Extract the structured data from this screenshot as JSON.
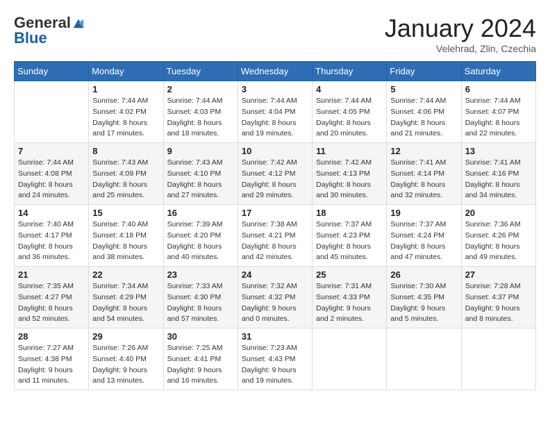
{
  "logo": {
    "general": "General",
    "blue": "Blue"
  },
  "header": {
    "month": "January 2024",
    "location": "Velehrad, Zlin, Czechia"
  },
  "weekdays": [
    "Sunday",
    "Monday",
    "Tuesday",
    "Wednesday",
    "Thursday",
    "Friday",
    "Saturday"
  ],
  "weeks": [
    [
      {
        "day": "",
        "sunrise": "",
        "sunset": "",
        "daylight": ""
      },
      {
        "day": "1",
        "sunrise": "Sunrise: 7:44 AM",
        "sunset": "Sunset: 4:02 PM",
        "daylight": "Daylight: 8 hours and 17 minutes."
      },
      {
        "day": "2",
        "sunrise": "Sunrise: 7:44 AM",
        "sunset": "Sunset: 4:03 PM",
        "daylight": "Daylight: 8 hours and 18 minutes."
      },
      {
        "day": "3",
        "sunrise": "Sunrise: 7:44 AM",
        "sunset": "Sunset: 4:04 PM",
        "daylight": "Daylight: 8 hours and 19 minutes."
      },
      {
        "day": "4",
        "sunrise": "Sunrise: 7:44 AM",
        "sunset": "Sunset: 4:05 PM",
        "daylight": "Daylight: 8 hours and 20 minutes."
      },
      {
        "day": "5",
        "sunrise": "Sunrise: 7:44 AM",
        "sunset": "Sunset: 4:06 PM",
        "daylight": "Daylight: 8 hours and 21 minutes."
      },
      {
        "day": "6",
        "sunrise": "Sunrise: 7:44 AM",
        "sunset": "Sunset: 4:07 PM",
        "daylight": "Daylight: 8 hours and 22 minutes."
      }
    ],
    [
      {
        "day": "7",
        "sunrise": "Sunrise: 7:44 AM",
        "sunset": "Sunset: 4:08 PM",
        "daylight": "Daylight: 8 hours and 24 minutes."
      },
      {
        "day": "8",
        "sunrise": "Sunrise: 7:43 AM",
        "sunset": "Sunset: 4:09 PM",
        "daylight": "Daylight: 8 hours and 25 minutes."
      },
      {
        "day": "9",
        "sunrise": "Sunrise: 7:43 AM",
        "sunset": "Sunset: 4:10 PM",
        "daylight": "Daylight: 8 hours and 27 minutes."
      },
      {
        "day": "10",
        "sunrise": "Sunrise: 7:42 AM",
        "sunset": "Sunset: 4:12 PM",
        "daylight": "Daylight: 8 hours and 29 minutes."
      },
      {
        "day": "11",
        "sunrise": "Sunrise: 7:42 AM",
        "sunset": "Sunset: 4:13 PM",
        "daylight": "Daylight: 8 hours and 30 minutes."
      },
      {
        "day": "12",
        "sunrise": "Sunrise: 7:41 AM",
        "sunset": "Sunset: 4:14 PM",
        "daylight": "Daylight: 8 hours and 32 minutes."
      },
      {
        "day": "13",
        "sunrise": "Sunrise: 7:41 AM",
        "sunset": "Sunset: 4:16 PM",
        "daylight": "Daylight: 8 hours and 34 minutes."
      }
    ],
    [
      {
        "day": "14",
        "sunrise": "Sunrise: 7:40 AM",
        "sunset": "Sunset: 4:17 PM",
        "daylight": "Daylight: 8 hours and 36 minutes."
      },
      {
        "day": "15",
        "sunrise": "Sunrise: 7:40 AM",
        "sunset": "Sunset: 4:18 PM",
        "daylight": "Daylight: 8 hours and 38 minutes."
      },
      {
        "day": "16",
        "sunrise": "Sunrise: 7:39 AM",
        "sunset": "Sunset: 4:20 PM",
        "daylight": "Daylight: 8 hours and 40 minutes."
      },
      {
        "day": "17",
        "sunrise": "Sunrise: 7:38 AM",
        "sunset": "Sunset: 4:21 PM",
        "daylight": "Daylight: 8 hours and 42 minutes."
      },
      {
        "day": "18",
        "sunrise": "Sunrise: 7:37 AM",
        "sunset": "Sunset: 4:23 PM",
        "daylight": "Daylight: 8 hours and 45 minutes."
      },
      {
        "day": "19",
        "sunrise": "Sunrise: 7:37 AM",
        "sunset": "Sunset: 4:24 PM",
        "daylight": "Daylight: 8 hours and 47 minutes."
      },
      {
        "day": "20",
        "sunrise": "Sunrise: 7:36 AM",
        "sunset": "Sunset: 4:26 PM",
        "daylight": "Daylight: 8 hours and 49 minutes."
      }
    ],
    [
      {
        "day": "21",
        "sunrise": "Sunrise: 7:35 AM",
        "sunset": "Sunset: 4:27 PM",
        "daylight": "Daylight: 8 hours and 52 minutes."
      },
      {
        "day": "22",
        "sunrise": "Sunrise: 7:34 AM",
        "sunset": "Sunset: 4:29 PM",
        "daylight": "Daylight: 8 hours and 54 minutes."
      },
      {
        "day": "23",
        "sunrise": "Sunrise: 7:33 AM",
        "sunset": "Sunset: 4:30 PM",
        "daylight": "Daylight: 8 hours and 57 minutes."
      },
      {
        "day": "24",
        "sunrise": "Sunrise: 7:32 AM",
        "sunset": "Sunset: 4:32 PM",
        "daylight": "Daylight: 9 hours and 0 minutes."
      },
      {
        "day": "25",
        "sunrise": "Sunrise: 7:31 AM",
        "sunset": "Sunset: 4:33 PM",
        "daylight": "Daylight: 9 hours and 2 minutes."
      },
      {
        "day": "26",
        "sunrise": "Sunrise: 7:30 AM",
        "sunset": "Sunset: 4:35 PM",
        "daylight": "Daylight: 9 hours and 5 minutes."
      },
      {
        "day": "27",
        "sunrise": "Sunrise: 7:28 AM",
        "sunset": "Sunset: 4:37 PM",
        "daylight": "Daylight: 9 hours and 8 minutes."
      }
    ],
    [
      {
        "day": "28",
        "sunrise": "Sunrise: 7:27 AM",
        "sunset": "Sunset: 4:38 PM",
        "daylight": "Daylight: 9 hours and 11 minutes."
      },
      {
        "day": "29",
        "sunrise": "Sunrise: 7:26 AM",
        "sunset": "Sunset: 4:40 PM",
        "daylight": "Daylight: 9 hours and 13 minutes."
      },
      {
        "day": "30",
        "sunrise": "Sunrise: 7:25 AM",
        "sunset": "Sunset: 4:41 PM",
        "daylight": "Daylight: 9 hours and 16 minutes."
      },
      {
        "day": "31",
        "sunrise": "Sunrise: 7:23 AM",
        "sunset": "Sunset: 4:43 PM",
        "daylight": "Daylight: 9 hours and 19 minutes."
      },
      {
        "day": "",
        "sunrise": "",
        "sunset": "",
        "daylight": ""
      },
      {
        "day": "",
        "sunrise": "",
        "sunset": "",
        "daylight": ""
      },
      {
        "day": "",
        "sunrise": "",
        "sunset": "",
        "daylight": ""
      }
    ]
  ]
}
